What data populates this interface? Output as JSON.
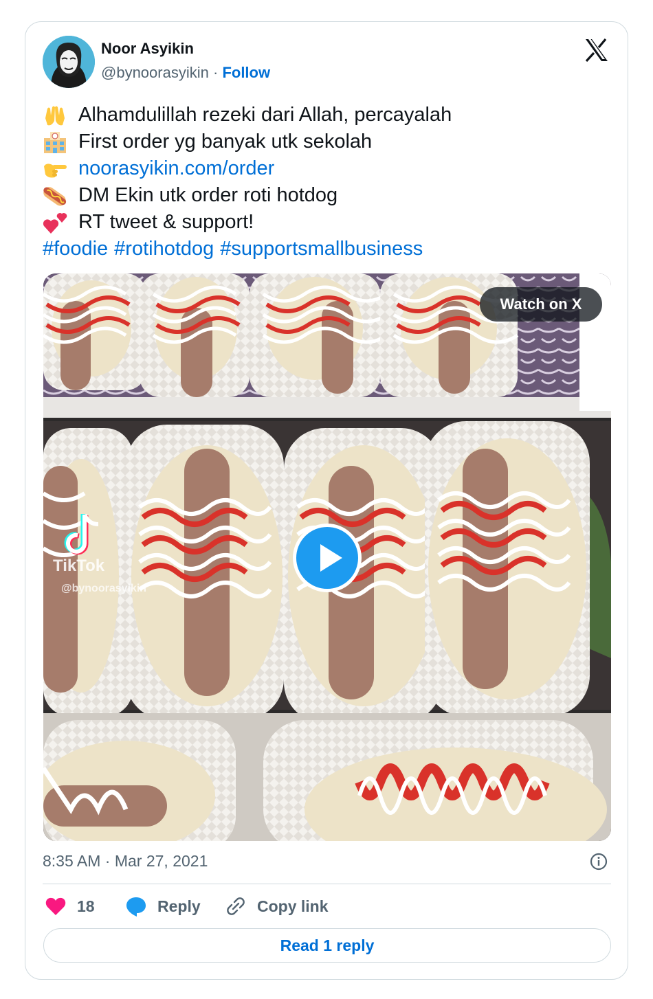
{
  "author": {
    "name": "Noor Asyikin",
    "handle": "@bynoorasyikin",
    "separator": "·",
    "follow_label": "Follow"
  },
  "tweet": {
    "line1": "Alhamdulillah rezeki dari Allah, percayalah",
    "line2": "First order yg banyak utk sekolah",
    "line3_link": "noorasyikin.com/order",
    "line4": "DM Ekin utk order roti hotdog",
    "line5": "RT tweet & support!",
    "hashtags": [
      "#foodie",
      "#rotihotdog",
      "#supportsmallbusiness"
    ],
    "emoji_icons": [
      "raised-hands-icon",
      "school-icon",
      "pointing-right-icon",
      "hotdog-icon",
      "two-hearts-icon"
    ]
  },
  "media": {
    "watch_label": "Watch on X",
    "watermark_brand": "TikTok",
    "watermark_handle": "@bynoorasyikin"
  },
  "meta": {
    "timestamp": "8:35 AM · Mar 27, 2021"
  },
  "actions": {
    "like_count": "18",
    "reply_label": "Reply",
    "copy_label": "Copy link",
    "read_replies_label": "Read 1 reply"
  },
  "colors": {
    "link": "#006fd6",
    "like": "#f91880",
    "reply_icon": "#1d9bf0",
    "play": "#1d9bf0",
    "secondary_text": "#536471",
    "border": "#cfd9de"
  }
}
